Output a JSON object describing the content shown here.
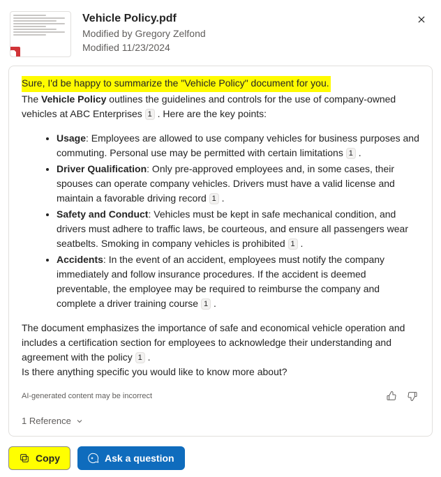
{
  "file": {
    "title": "Vehicle Policy.pdf",
    "modifiedBy": "Modified by Gregory Zelfond",
    "modifiedDate": "Modified 11/23/2024"
  },
  "summary": {
    "intro_highlight": "Sure, I'd be happy to summarize the \"Vehicle Policy\" document for you.",
    "line1_prefix": "The ",
    "line1_bold": "Vehicle Policy",
    "line1_mid": " outlines the guidelines and controls for the use of company-owned vehicles at ABC Enterprises ",
    "line1_suffix": " . Here are the key points:",
    "ref_label": "1",
    "bullets": [
      {
        "title": "Usage",
        "text": ": Employees are allowed to use company vehicles for business purposes and commuting. Personal use may be permitted with certain limitations ",
        "has_ref": true
      },
      {
        "title": "Driver Qualification",
        "text": ": Only pre-approved employees and, in some cases, their spouses can operate company vehicles. Drivers must have a valid license and maintain a favorable driving record ",
        "has_ref": true
      },
      {
        "title": "Safety and Conduct",
        "text": ": Vehicles must be kept in safe mechanical condition, and drivers must adhere to traffic laws, be courteous, and ensure all passengers wear seatbelts. Smoking in company vehicles is prohibited ",
        "has_ref": true
      },
      {
        "title": "Accidents",
        "text": ": In the event of an accident, employees must notify the company immediately and follow insurance procedures. If the accident is deemed preventable, the employee may be required to reimburse the company and complete a driver training course ",
        "has_ref": true
      }
    ],
    "closing1": "The document emphasizes the importance of safe and economical vehicle operation and includes a certification section for employees to acknowledge their understanding and agreement with the policy ",
    "closing1_suffix": " .",
    "closing2": "Is there anything specific you would like to know more about?",
    "disclaimer": "AI-generated content may be incorrect",
    "references_label": "1 Reference"
  },
  "actions": {
    "copy": "Copy",
    "ask": "Ask a question"
  }
}
